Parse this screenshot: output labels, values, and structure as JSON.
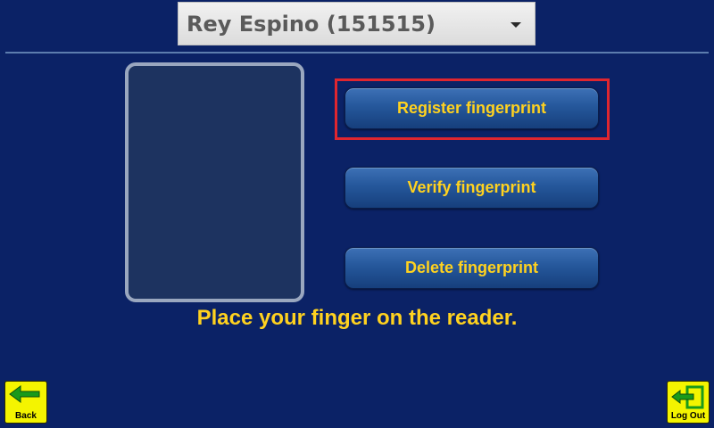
{
  "header": {
    "selected_user": "Rey Espino (151515)"
  },
  "actions": {
    "register_label": "Register fingerprint",
    "verify_label": "Verify fingerprint",
    "delete_label": "Delete fingerprint"
  },
  "instruction": "Place your finger on the reader.",
  "footer": {
    "back_label": "Back",
    "logout_label": "Log Out"
  },
  "colors": {
    "background": "#0b2266",
    "accent_text": "#ffd21f",
    "corner_button": "#f4f400",
    "icon_green": "#1a9a1a",
    "highlight": "#e0262f"
  },
  "icons": {
    "back": "left-arrow-icon",
    "logout": "exit-door-icon",
    "dropdown": "caret-down-icon"
  }
}
